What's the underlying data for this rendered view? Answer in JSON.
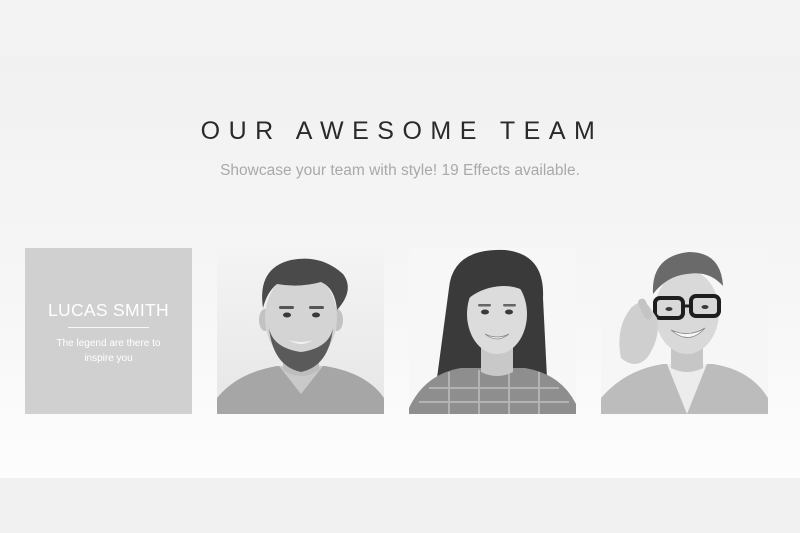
{
  "section": {
    "title": "OUR AWESOME TEAM",
    "subtitle": "Showcase your team with style! 19 Effects available."
  },
  "team": [
    {
      "name": "LUCAS SMITH",
      "description": "The legend are there to inspire you",
      "state": "hover-overlay"
    },
    {
      "photo": "man-with-beard-portrait",
      "state": "default"
    },
    {
      "photo": "woman-long-hair-portrait",
      "state": "default"
    },
    {
      "photo": "man-with-glasses-portrait",
      "state": "default"
    }
  ],
  "colors": {
    "background": "#f2f2f2",
    "overlay": "#d0d0d0",
    "title": "#2a2a2a",
    "subtitle": "#a9a9a9"
  }
}
